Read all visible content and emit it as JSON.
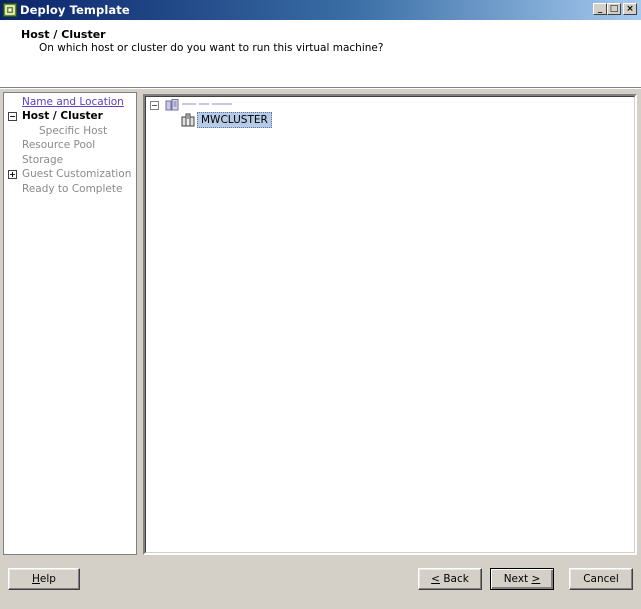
{
  "window": {
    "title": "Deploy Template",
    "controls": {
      "minimize": "_",
      "maximize": "□",
      "close": "×"
    }
  },
  "header": {
    "title": "Host / Cluster",
    "description": "On which host or cluster do you want to run this virtual machine?"
  },
  "nav": {
    "items": [
      {
        "label": "Name and Location",
        "state": "link"
      },
      {
        "label": "Host / Cluster",
        "state": "current",
        "expander": "⊟"
      },
      {
        "label": "Specific Host",
        "state": "disabled"
      },
      {
        "label": "Resource Pool",
        "state": "disabled"
      },
      {
        "label": "Storage",
        "state": "disabled"
      },
      {
        "label": "Guest Customization",
        "state": "disabled",
        "expander": "⊞"
      },
      {
        "label": "Ready to Complete",
        "state": "disabled"
      }
    ]
  },
  "tree": {
    "root_expander": "−",
    "root_icon": "datacenter-icon",
    "cluster": {
      "label": "MWCLUSTER",
      "icon": "cluster-icon",
      "selected": true
    }
  },
  "buttons": {
    "help": {
      "mnemonic": "H",
      "rest": "elp"
    },
    "back": {
      "prefix": "< ",
      "mnemonic": "B",
      "rest": "ack",
      "display_prefix": "<",
      "display_rest": "Back"
    },
    "next": {
      "text": "Next ",
      "mnemonic": ">"
    },
    "cancel": "Cancel"
  },
  "colors": {
    "titlebar_start": "#0a246a",
    "titlebar_end": "#a6caf0",
    "window_bg": "#d4d0c8",
    "link": "#6040c0",
    "disabled_text": "#8a8a8a",
    "selection": "#b6cbe6"
  }
}
